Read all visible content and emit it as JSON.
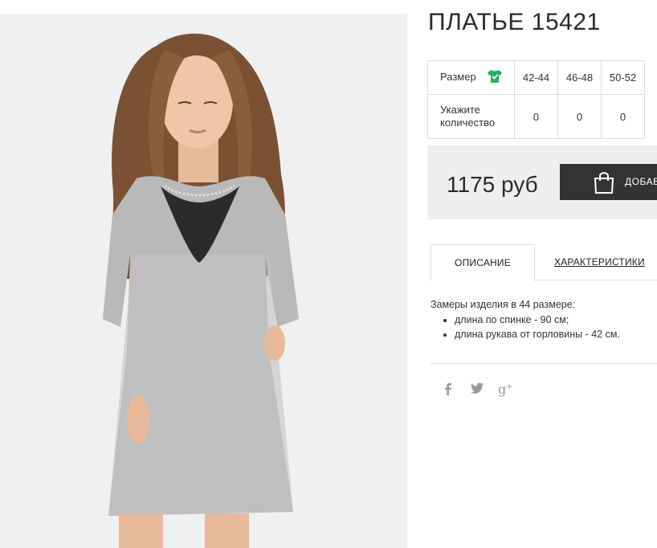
{
  "product": {
    "title": "ПЛАТЬЕ 15421",
    "image_alt": "Серое платье с кружевным воротником"
  },
  "size_table": {
    "size_label": "Размер",
    "size_icon": "tshirt-icon",
    "sizes": [
      "42-44",
      "46-48",
      "50-52"
    ],
    "qty_label_line1": "Укажите",
    "qty_label_line2": "количество",
    "quantities": [
      "0",
      "0",
      "0"
    ]
  },
  "purchase": {
    "price": "1175 руб",
    "add_button_label": "ДОБАВИТЬ В КОРЗИНУ",
    "bag_icon": "shopping-bag-icon"
  },
  "tabs": {
    "description": "ОПИСАНИЕ",
    "characteristics": "ХАРАКТЕРИСТИКИ"
  },
  "description": {
    "intro": "Замеры изделия в 44 размере:",
    "items": [
      "длина по спинке - 90 см;",
      "длина рукава от горловины - 42 см."
    ]
  },
  "social": {
    "facebook": "f",
    "twitter": "twitter-icon",
    "google_plus": "g+"
  },
  "colors": {
    "accent_icon": "#27ae60",
    "button_bg": "#333333",
    "price_box_bg": "#eeeeee"
  }
}
